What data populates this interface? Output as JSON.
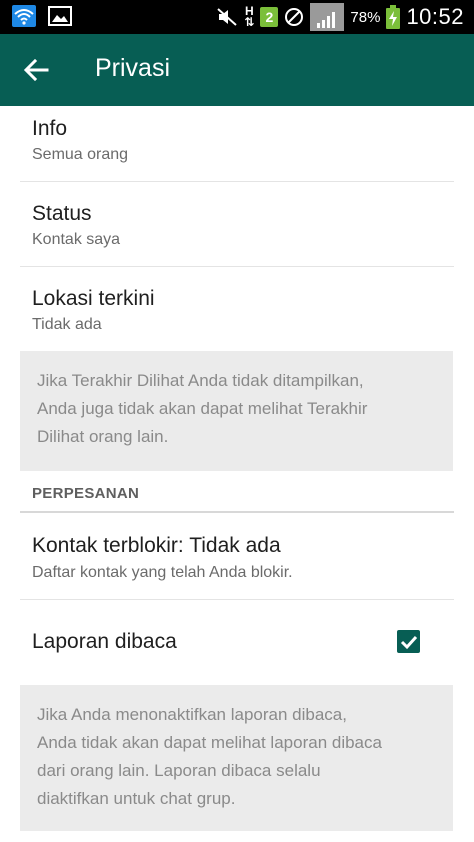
{
  "status_bar": {
    "network_type": "H",
    "sim_slot": "2",
    "battery_percent": "78%",
    "time": "10:52"
  },
  "toolbar": {
    "title": "Privasi"
  },
  "items": {
    "info": {
      "title": "Info",
      "summary": "Semua orang"
    },
    "status": {
      "title": "Status",
      "summary": "Kontak saya"
    },
    "location": {
      "title": "Lokasi terkini",
      "summary": "Tidak ada"
    }
  },
  "last_seen_note": {
    "line1": "Jika Terakhir Dilihat Anda tidak ditampilkan,",
    "line2": "Anda juga tidak akan dapat melihat Terakhir",
    "line3": "Dilihat orang lain."
  },
  "messaging_section": {
    "header": "PERPESANAN",
    "blocked": {
      "title": "Kontak terblokir: Tidak ada",
      "summary": "Daftar kontak yang telah Anda blokir."
    },
    "read_receipts": {
      "title": "Laporan dibaca",
      "checked": true
    }
  },
  "read_receipts_note": {
    "line1": "Jika Anda menonaktifkan laporan dibaca,",
    "line2": "Anda tidak akan dapat melihat laporan dibaca",
    "line3": "dari orang lain. Laporan dibaca selalu",
    "line4": "diaktifkan untuk chat grup."
  },
  "colors": {
    "toolbar": "#075e54",
    "checkbox": "#075e54",
    "note_background": "#ebebeb"
  }
}
